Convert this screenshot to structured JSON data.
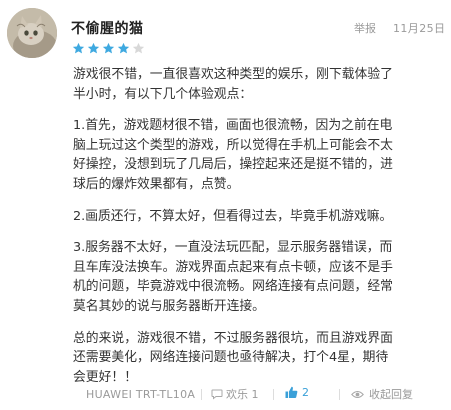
{
  "review": {
    "username": "不偷腥的猫",
    "rating": 4,
    "rating_max": 5,
    "report_label": "举报",
    "date": "11月25日",
    "paragraphs": [
      "游戏很不错，一直很喜欢这种类型的娱乐，刚下载体验了\n半小时，有以下几个体验观点：",
      "1.首先，游戏题材很不错，画面也很流畅，因为之前在电\n脑上玩过这个类型的游戏，所以觉得在手机上可能会不太\n好操控，没想到玩了几局后，操控起来还是挺不错的，进\n球后的爆炸效果都有，点赞。",
      "2.画质还行，不算太好，但看得过去，毕竟手机游戏嘛。",
      "3.服务器不太好，一直没法玩匹配，显示服务器错误，而\n且车库没法换车。游戏界面点起来有点卡顿，应该不是手\n机的问题，毕竟游戏中很流畅。网络连接有点问题，经常\n莫名其妙的说与服务器断开连接。",
      "总的来说，游戏很不错，不过服务器很坑，而且游戏界面\n还需要美化，网络连接问题也亟待解决，打个4星，期待\n会更好！！"
    ],
    "device": "HUAWEI TRT-TL10A",
    "comment_label": "欢乐 1",
    "like_count": "2",
    "collapse_label": "收起回复"
  },
  "colors": {
    "star": "#3fa9e0",
    "star_empty": "#d8d8d8",
    "like": "#3aa0d8",
    "muted": "#9a9a9a"
  },
  "icons": {
    "avatar": "cat-photo-avatar",
    "rating": "star-icon",
    "comment": "chat-bubble-icon",
    "like": "thumbs-up-icon",
    "collapse": "eye-icon"
  }
}
